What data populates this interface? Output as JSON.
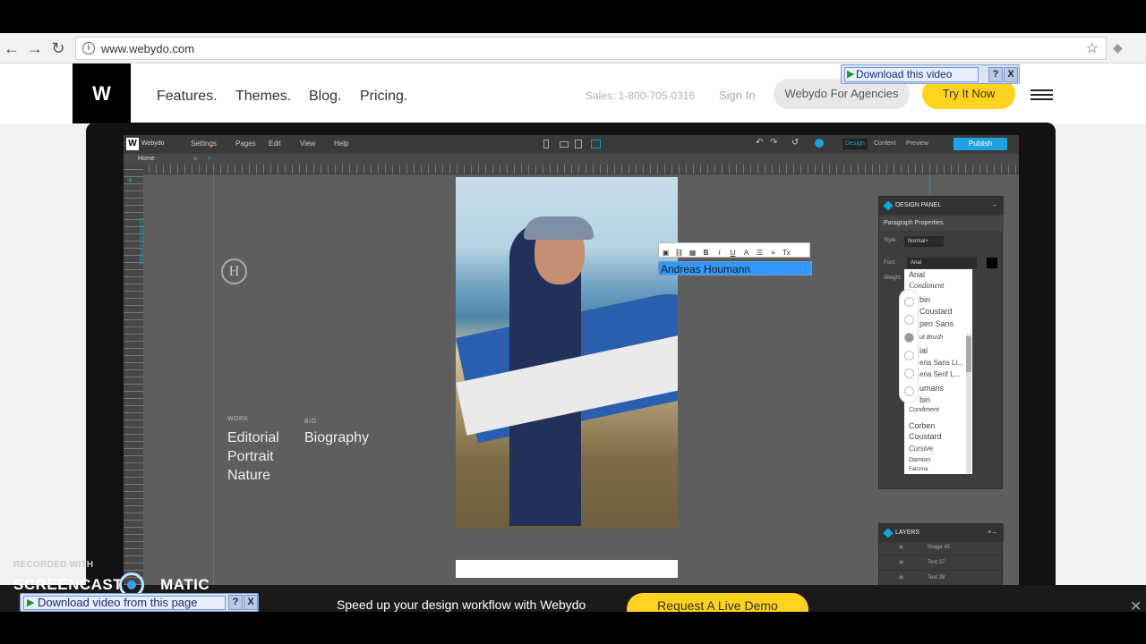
{
  "browser": {
    "url": "www.webydo.com"
  },
  "site": {
    "logo": "W",
    "nav": [
      "Features.",
      "Themes.",
      "Blog.",
      "Pricing."
    ],
    "sales": "Sales: 1-800-705-0316",
    "sign_in": "Sign In",
    "agencies": "Webydo For Agencies",
    "try_it": "Try It Now"
  },
  "download_bar": {
    "label": "Download this video",
    "help": "?",
    "close": "X"
  },
  "editor": {
    "brand": "Webydo",
    "menus": [
      "Settings",
      "Pages",
      "Edit",
      "View",
      "Help"
    ],
    "modes": [
      "Design",
      "Content",
      "Preview"
    ],
    "publish": "Publish",
    "page_tab": "Home",
    "elements_panel": "ELEMENTS PANEL",
    "canvas": {
      "work_label": "WORK",
      "bio_label": "BIO",
      "work_items": [
        "Editorial",
        "Portrait",
        "Nature"
      ],
      "bio_items": [
        "Biography"
      ],
      "selected_text": "Andreas Houmann"
    },
    "design_panel": {
      "title": "DESIGN PANEL",
      "section": "Paragraph Properties",
      "style_label": "Style:",
      "style_value": "Normal+",
      "font_label": "Font:",
      "font_value": "Arial",
      "weight_label": "Weight:",
      "font_options": [
        "Arial",
        "Condiment",
        "bin",
        "Coustard",
        "pen Sans",
        "ut Brush",
        "ial",
        "eria Sans Li...",
        "eria Serif L...",
        "umans",
        "bin",
        "Condiment",
        "Corben",
        "Coustard",
        "Cursive",
        "Damion",
        "Fanzina"
      ]
    },
    "layers_panel": {
      "title": "LAYERS",
      "rows": [
        "Image 45",
        "Text 37",
        "Text 38"
      ]
    }
  },
  "promo_bar": {
    "message": "Speed up your design workflow with Webydo",
    "button": "Request A Live Demo"
  },
  "watermark": {
    "recorded_with": "RECORDED WITH",
    "brand": "SCREENCAST",
    "brand2": "MATIC"
  },
  "download_page": {
    "label": "Download video from this page",
    "help": "?",
    "close": "X"
  }
}
